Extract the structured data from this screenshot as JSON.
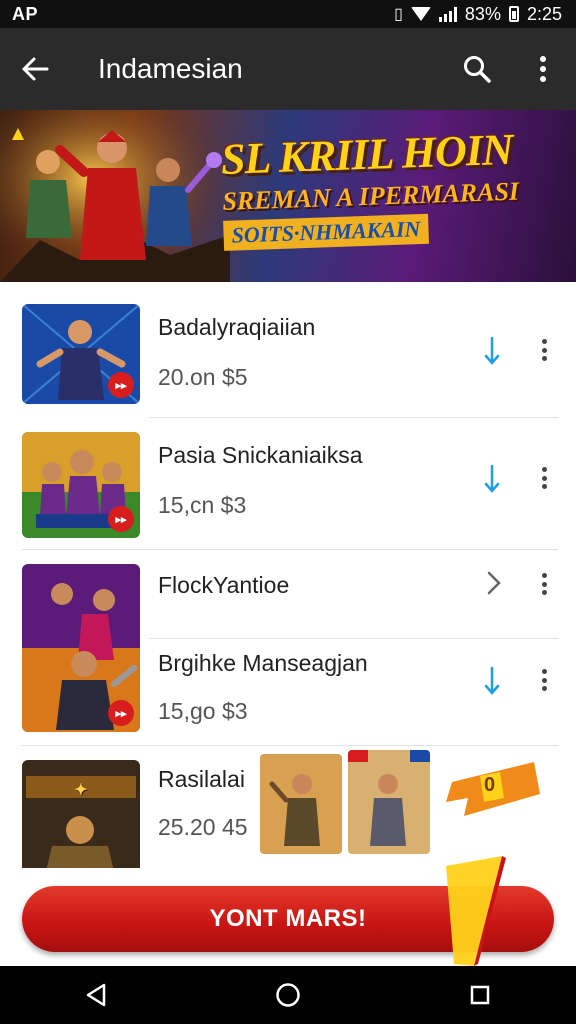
{
  "status_bar": {
    "left": "AP",
    "battery": "83%",
    "time": "2:25"
  },
  "app_bar": {
    "title": "Indamesian",
    "back_icon": "arrow-left-icon",
    "search_icon": "search-icon",
    "more_icon": "more-vert-icon"
  },
  "banner": {
    "line1": "SL KRIIL HOIN",
    "line2": "SREMAN A IPERMARASI",
    "line3": "SOITS·NHMAKAIN"
  },
  "list": {
    "items": [
      {
        "name": "Badalyraqiaiian",
        "meta": "20.on  $5",
        "action": "download-icon"
      },
      {
        "name": "Pasia Snickaniaiksa",
        "meta": "15,cn  $3",
        "action": "download-icon"
      },
      {
        "name": "FlockYantioe",
        "meta": "",
        "action": "chevron-right-icon"
      },
      {
        "name": "Brgihke Manseagjan",
        "meta": "15,go  $3",
        "action": "download-icon"
      },
      {
        "name": "Rasilalai",
        "meta": "25.20  45",
        "action": ""
      }
    ],
    "promo_badge": "0"
  },
  "cta": {
    "label": "YONT MARS!",
    "color": "#c81414"
  },
  "colors": {
    "accent": "#1e9ee8",
    "appbar": "#2b2b2b",
    "cta": "#c81414"
  }
}
